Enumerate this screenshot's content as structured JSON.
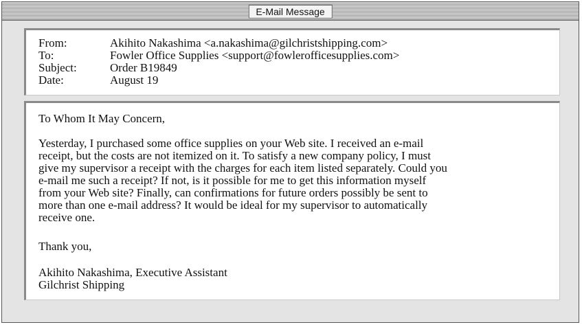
{
  "window": {
    "title": "E-Mail Message"
  },
  "header": {
    "from_label": "From:",
    "from_value": "Akihito Nakashima <a.nakashima@gilchristshipping.com>",
    "to_label": "To:",
    "to_value": "Fowler Office Supplies <support@fowlerofficesupplies.com>",
    "subject_label": "Subject:",
    "subject_value": "Order B19849",
    "date_label": "Date:",
    "date_value": "August 19"
  },
  "message": {
    "greeting": "To Whom It May Concern,",
    "body_lines": [
      "Yesterday, I purchased some office supplies on your Web site. I received an e-mail",
      "receipt, but the costs are not itemized on it. To satisfy a new company policy, I must",
      "give my supervisor a receipt with the charges for each item listed separately. Could you",
      "e-mail me such a receipt? If not, is it possible for me to get this information myself",
      "from your Web site? Finally, can confirmations for future orders possibly be sent to",
      "more than one e-mail address? It would be ideal for my supervisor to automatically",
      "receive one."
    ],
    "closing": "Thank you,",
    "signature_name": "Akihito Nakashima, Executive Assistant",
    "signature_company": "Gilchrist Shipping"
  }
}
